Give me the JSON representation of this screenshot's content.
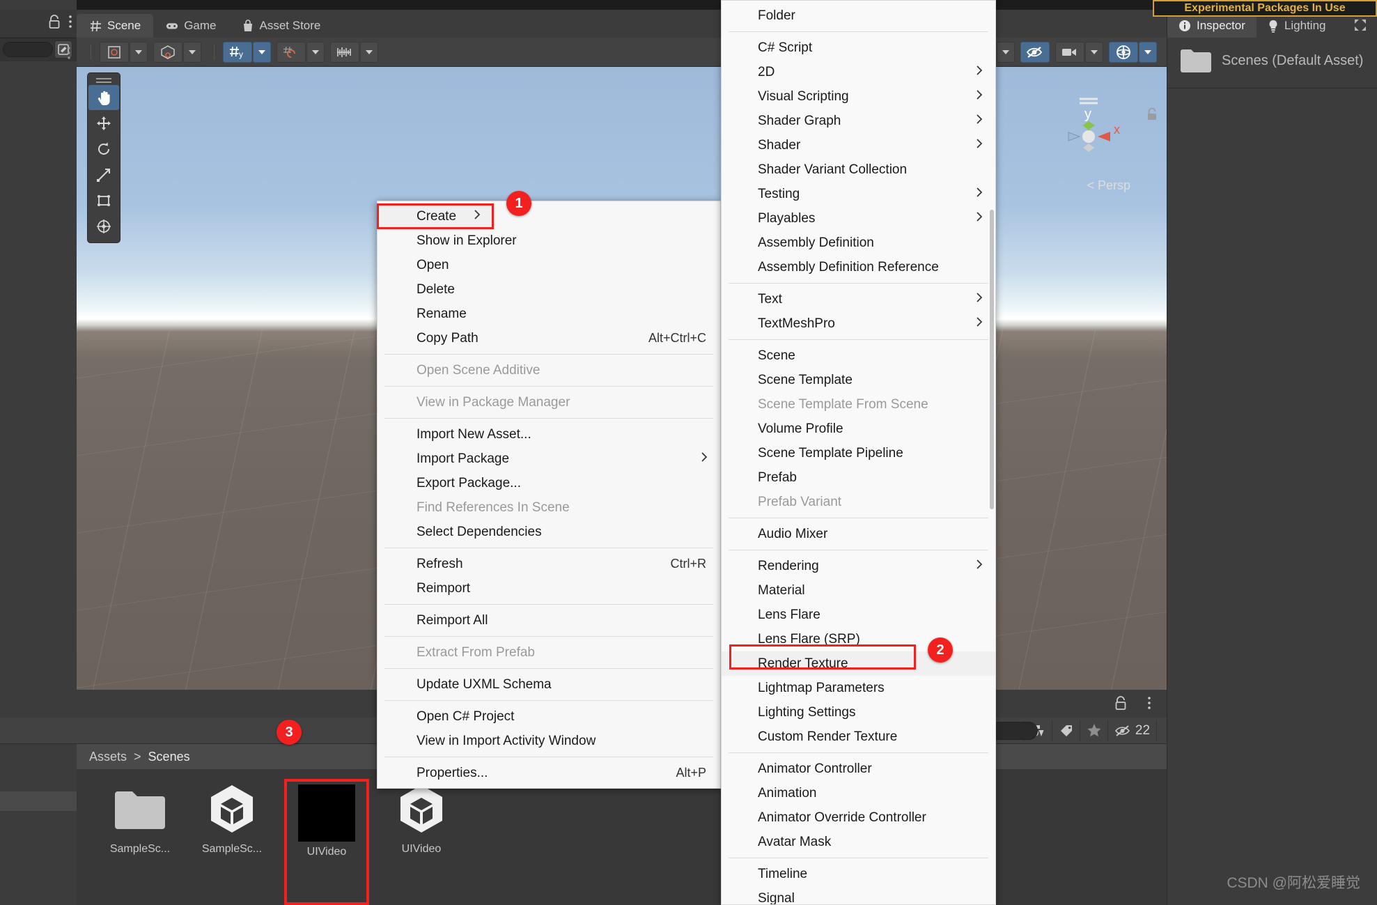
{
  "scene_panel": {
    "tabs": [
      {
        "label": "Scene",
        "icon": "grid-icon",
        "active": true
      },
      {
        "label": "Game",
        "icon": "gamepad-icon",
        "active": false
      },
      {
        "label": "Asset Store",
        "icon": "shoppingbag-icon",
        "active": false
      }
    ],
    "toolbar": {
      "pivot_label": "pivot-rotate-toggle",
      "handle_label": "handle-space-toggle",
      "grid_label": "grid-visibility-toggle",
      "snap_label": "snap-increment-toggle",
      "layers_label": "component-editor-toggle",
      "fx_label": "scene-fx-toggle",
      "audio_label": "scene-audio-toggle",
      "camera_label": "scene-camera-toggle",
      "gizmo_label": "gizmos-toggle"
    },
    "tools": [
      {
        "name": "hand-tool",
        "selected": true
      },
      {
        "name": "move-tool",
        "selected": false
      },
      {
        "name": "rotate-tool",
        "selected": false
      },
      {
        "name": "scale-tool",
        "selected": false
      },
      {
        "name": "rect-tool",
        "selected": false
      },
      {
        "name": "transform-tool",
        "selected": false
      }
    ],
    "gizmo": {
      "axis_y": "y",
      "axis_x": "x",
      "view_mode": "Persp",
      "persp_prefix": "<"
    }
  },
  "project_panel": {
    "breadcrumb": {
      "root": "Assets",
      "separator": ">",
      "current": "Scenes"
    },
    "hidden_count": "22",
    "assets": [
      {
        "label": "SampleSc...",
        "thumb": "folder-thumb",
        "highlighted": false
      },
      {
        "label": "SampleSc...",
        "thumb": "unity-scene-thumb",
        "highlighted": false
      },
      {
        "label": "UIVideo",
        "thumb": "black-render-texture-thumb",
        "highlighted": true
      },
      {
        "label": "UIVideo",
        "thumb": "unity-scene-thumb",
        "highlighted": false
      }
    ]
  },
  "inspector_panel": {
    "tabs": [
      {
        "label": "Inspector",
        "icon": "info-icon",
        "active": true
      },
      {
        "label": "Lighting",
        "icon": "bulb-icon",
        "active": false
      }
    ],
    "selected_asset": "Scenes (Default Asset)",
    "experimental_banner": "Experimental Packages In Use"
  },
  "context_menu": {
    "items": [
      {
        "label": "Create",
        "shortcut": "",
        "submenu": true,
        "disabled": false,
        "highlighted": true,
        "boxed": true
      },
      {
        "label": "Show in Explorer",
        "shortcut": "",
        "submenu": false,
        "disabled": false
      },
      {
        "label": "Open",
        "shortcut": "",
        "submenu": false,
        "disabled": false
      },
      {
        "label": "Delete",
        "shortcut": "",
        "submenu": false,
        "disabled": false
      },
      {
        "label": "Rename",
        "shortcut": "",
        "submenu": false,
        "disabled": false
      },
      {
        "label": "Copy Path",
        "shortcut": "Alt+Ctrl+C",
        "submenu": false,
        "disabled": false
      },
      {
        "separator": true
      },
      {
        "label": "Open Scene Additive",
        "shortcut": "",
        "submenu": false,
        "disabled": true
      },
      {
        "separator": true
      },
      {
        "label": "View in Package Manager",
        "shortcut": "",
        "submenu": false,
        "disabled": true
      },
      {
        "separator": true
      },
      {
        "label": "Import New Asset...",
        "shortcut": "",
        "submenu": false,
        "disabled": false
      },
      {
        "label": "Import Package",
        "shortcut": "",
        "submenu": true,
        "disabled": false
      },
      {
        "label": "Export Package...",
        "shortcut": "",
        "submenu": false,
        "disabled": false
      },
      {
        "label": "Find References In Scene",
        "shortcut": "",
        "submenu": false,
        "disabled": true
      },
      {
        "label": "Select Dependencies",
        "shortcut": "",
        "submenu": false,
        "disabled": false
      },
      {
        "separator": true
      },
      {
        "label": "Refresh",
        "shortcut": "Ctrl+R",
        "submenu": false,
        "disabled": false
      },
      {
        "label": "Reimport",
        "shortcut": "",
        "submenu": false,
        "disabled": false
      },
      {
        "separator": true
      },
      {
        "label": "Reimport All",
        "shortcut": "",
        "submenu": false,
        "disabled": false
      },
      {
        "separator": true
      },
      {
        "label": "Extract From Prefab",
        "shortcut": "",
        "submenu": false,
        "disabled": true
      },
      {
        "separator": true
      },
      {
        "label": "Update UXML Schema",
        "shortcut": "",
        "submenu": false,
        "disabled": false
      },
      {
        "separator": true
      },
      {
        "label": "Open C# Project",
        "shortcut": "",
        "submenu": false,
        "disabled": false
      },
      {
        "label": "View in Import Activity Window",
        "shortcut": "",
        "submenu": false,
        "disabled": false
      },
      {
        "separator": true
      },
      {
        "label": "Properties...",
        "shortcut": "Alt+P",
        "submenu": false,
        "disabled": false
      }
    ]
  },
  "create_submenu": {
    "items": [
      {
        "label": "Folder",
        "submenu": false,
        "disabled": false
      },
      {
        "separator": true
      },
      {
        "label": "C# Script",
        "submenu": false,
        "disabled": false
      },
      {
        "label": "2D",
        "submenu": true,
        "disabled": false
      },
      {
        "label": "Visual Scripting",
        "submenu": true,
        "disabled": false
      },
      {
        "label": "Shader Graph",
        "submenu": true,
        "disabled": false
      },
      {
        "label": "Shader",
        "submenu": true,
        "disabled": false
      },
      {
        "label": "Shader Variant Collection",
        "submenu": false,
        "disabled": false
      },
      {
        "label": "Testing",
        "submenu": true,
        "disabled": false
      },
      {
        "label": "Playables",
        "submenu": true,
        "disabled": false
      },
      {
        "label": "Assembly Definition",
        "submenu": false,
        "disabled": false
      },
      {
        "label": "Assembly Definition Reference",
        "submenu": false,
        "disabled": false
      },
      {
        "separator": true
      },
      {
        "label": "Text",
        "submenu": true,
        "disabled": false
      },
      {
        "label": "TextMeshPro",
        "submenu": true,
        "disabled": false
      },
      {
        "separator": true
      },
      {
        "label": "Scene",
        "submenu": false,
        "disabled": false
      },
      {
        "label": "Scene Template",
        "submenu": false,
        "disabled": false
      },
      {
        "label": "Scene Template From Scene",
        "submenu": false,
        "disabled": true
      },
      {
        "label": "Volume Profile",
        "submenu": false,
        "disabled": false
      },
      {
        "label": "Scene Template Pipeline",
        "submenu": false,
        "disabled": false
      },
      {
        "label": "Prefab",
        "submenu": false,
        "disabled": false
      },
      {
        "label": "Prefab Variant",
        "submenu": false,
        "disabled": true
      },
      {
        "separator": true
      },
      {
        "label": "Audio Mixer",
        "submenu": false,
        "disabled": false
      },
      {
        "separator": true
      },
      {
        "label": "Rendering",
        "submenu": true,
        "disabled": false
      },
      {
        "label": "Material",
        "submenu": false,
        "disabled": false
      },
      {
        "label": "Lens Flare",
        "submenu": false,
        "disabled": false
      },
      {
        "label": "Lens Flare (SRP)",
        "submenu": false,
        "disabled": false
      },
      {
        "label": "Render Texture",
        "submenu": false,
        "disabled": false,
        "highlighted": true
      },
      {
        "label": "Lightmap Parameters",
        "submenu": false,
        "disabled": false
      },
      {
        "label": "Lighting Settings",
        "submenu": false,
        "disabled": false
      },
      {
        "label": "Custom Render Texture",
        "submenu": false,
        "disabled": false
      },
      {
        "separator": true
      },
      {
        "label": "Animator Controller",
        "submenu": false,
        "disabled": false
      },
      {
        "label": "Animation",
        "submenu": false,
        "disabled": false
      },
      {
        "label": "Animator Override Controller",
        "submenu": false,
        "disabled": false
      },
      {
        "label": "Avatar Mask",
        "submenu": false,
        "disabled": false
      },
      {
        "separator": true
      },
      {
        "label": "Timeline",
        "submenu": false,
        "disabled": false
      },
      {
        "label": "Signal",
        "submenu": false,
        "disabled": false
      }
    ]
  },
  "annotations": [
    {
      "number": "1",
      "target": "create-menu-item"
    },
    {
      "number": "2",
      "target": "render-texture-menu-item"
    },
    {
      "number": "3",
      "target": "uivideo-asset"
    }
  ],
  "watermark": "CSDN @阿松爱睡觉",
  "colors": {
    "accent_red": "#f4201f",
    "selected_blue": "#4a6d94",
    "panel_bg": "#383838",
    "menu_bg": "#f7f7f7",
    "banner_yellow": "#e3b23c"
  }
}
